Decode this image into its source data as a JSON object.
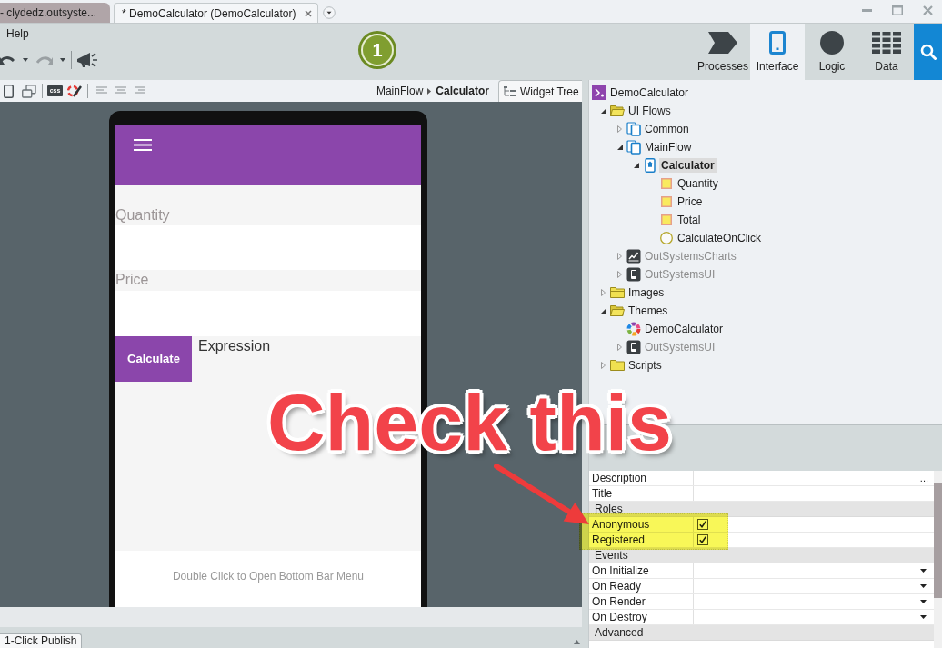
{
  "title_bar": {
    "tabs": [
      {
        "label": "- clydedz.outsyste...",
        "selected": false
      },
      {
        "label": "* DemoCalculator (DemoCalculator)",
        "selected": true
      }
    ]
  },
  "menu": [
    "Help"
  ],
  "publish_button": {
    "label": "1"
  },
  "nav_tabs": [
    {
      "label": "Processes",
      "kind": "processes",
      "selected": false
    },
    {
      "label": "Interface",
      "kind": "interface",
      "selected": true
    },
    {
      "label": "Logic",
      "kind": "logic",
      "selected": false
    },
    {
      "label": "Data",
      "kind": "data",
      "selected": false
    }
  ],
  "editor_toolbar": {
    "css_button": "css",
    "breadcrumb": [
      {
        "label": "MainFlow",
        "current": false
      },
      {
        "label": "Calculator",
        "current": true
      }
    ],
    "widget_tree_tab": "Widget Tree"
  },
  "preview": {
    "inputs": [
      {
        "label": "Quantity"
      },
      {
        "label": "Price"
      }
    ],
    "button": "Calculate",
    "expression": "Expression",
    "bottom_bar": "Double Click to Open Bottom Bar Menu"
  },
  "bottom_tabs": [
    {
      "label": "1-Click Publish",
      "selected": true
    }
  ],
  "tree": [
    {
      "label": "DemoCalculator",
      "kind": "module",
      "selected": false,
      "dimmed": false,
      "children": [
        {
          "label": "UI Flows",
          "kind": "folder",
          "expanded": true,
          "selected": false,
          "dimmed": false,
          "children": [
            {
              "label": "Common",
              "kind": "flow",
              "expanded": false,
              "selected": false,
              "dimmed": false
            },
            {
              "label": "MainFlow",
              "kind": "flow",
              "expanded": true,
              "selected": false,
              "dimmed": false,
              "children": [
                {
                  "label": "Calculator",
                  "kind": "screen",
                  "expanded": true,
                  "selected": true,
                  "dimmed": false,
                  "children": [
                    {
                      "label": "Quantity",
                      "kind": "variable",
                      "selected": false,
                      "dimmed": false
                    },
                    {
                      "label": "Price",
                      "kind": "variable",
                      "selected": false,
                      "dimmed": false
                    },
                    {
                      "label": "Total",
                      "kind": "variable",
                      "selected": false,
                      "dimmed": false
                    },
                    {
                      "label": "CalculateOnClick",
                      "kind": "action",
                      "selected": false,
                      "dimmed": false
                    }
                  ]
                }
              ]
            },
            {
              "label": "OutSystemsCharts",
              "kind": "charts",
              "expanded": false,
              "selected": false,
              "dimmed": true
            },
            {
              "label": "OutSystemsUI",
              "kind": "ui-module",
              "expanded": false,
              "selected": false,
              "dimmed": true
            }
          ]
        },
        {
          "label": "Images",
          "kind": "folder",
          "expanded": false,
          "selected": false,
          "dimmed": false
        },
        {
          "label": "Themes",
          "kind": "folder",
          "expanded": true,
          "selected": false,
          "dimmed": false,
          "children": [
            {
              "label": "DemoCalculator",
              "kind": "theme",
              "selected": false,
              "dimmed": false
            },
            {
              "label": "OutSystemsUI",
              "kind": "ui-module",
              "expanded": false,
              "selected": false,
              "dimmed": true
            }
          ]
        },
        {
          "label": "Scripts",
          "kind": "folder",
          "expanded": false,
          "selected": false,
          "dimmed": false
        }
      ]
    }
  ],
  "properties": {
    "rows": [
      {
        "kind": "field",
        "label": "Description",
        "button": "...",
        "highlighted": false
      },
      {
        "kind": "field",
        "label": "Title",
        "highlighted": false
      },
      {
        "kind": "section",
        "label": "Roles",
        "highlighted": false
      },
      {
        "kind": "checkbox",
        "label": "Anonymous",
        "checked": true,
        "highlighted": true
      },
      {
        "kind": "checkbox",
        "label": "Registered",
        "checked": true,
        "highlighted": true
      },
      {
        "kind": "section",
        "label": "Events",
        "highlighted": false
      },
      {
        "kind": "dropdown",
        "label": "On Initialize",
        "highlighted": false
      },
      {
        "kind": "dropdown",
        "label": "On Ready",
        "highlighted": false
      },
      {
        "kind": "dropdown",
        "label": "On Render",
        "highlighted": false
      },
      {
        "kind": "dropdown",
        "label": "On Destroy",
        "highlighted": false
      },
      {
        "kind": "section",
        "label": "Advanced",
        "highlighted": false
      }
    ]
  },
  "annotation": {
    "text": "Check this"
  }
}
